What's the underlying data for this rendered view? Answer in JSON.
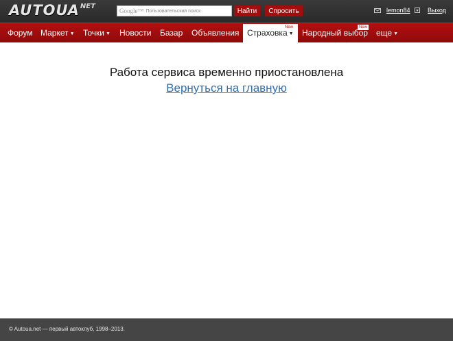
{
  "header": {
    "logo_main": "AUTOUA",
    "logo_net": "NET",
    "search": {
      "brand": "Google™",
      "placeholder": "Пользовательский поиск"
    },
    "find_label": "Найти",
    "ask_label": "Спросить",
    "username": "lemon84",
    "logout_label": "Выход"
  },
  "nav": {
    "items": [
      {
        "label": "Форум"
      },
      {
        "label": "Маркет",
        "caret": "▼"
      },
      {
        "label": "Точки",
        "caret": "▼"
      },
      {
        "label": "Новости"
      },
      {
        "label": "Базар"
      },
      {
        "label": "Объявления"
      },
      {
        "label": "Страховка",
        "caret": "▼",
        "badge": "New"
      },
      {
        "label": "Народный выбор",
        "badge": "New"
      },
      {
        "label": "еще",
        "caret": "▼"
      }
    ],
    "active_index": 6
  },
  "main": {
    "message": "Работа сервиса временно приостановлена",
    "home_link": "Вернуться на главную"
  },
  "footer": {
    "text": "© Autoua.net — первый автоклуб, 1998–2013."
  },
  "colors": {
    "topbar": "#2f2f2f",
    "navbar": "#a00d0d",
    "accent": "#a40d0d",
    "link": "#2f6fb3",
    "footer": "#454545"
  }
}
